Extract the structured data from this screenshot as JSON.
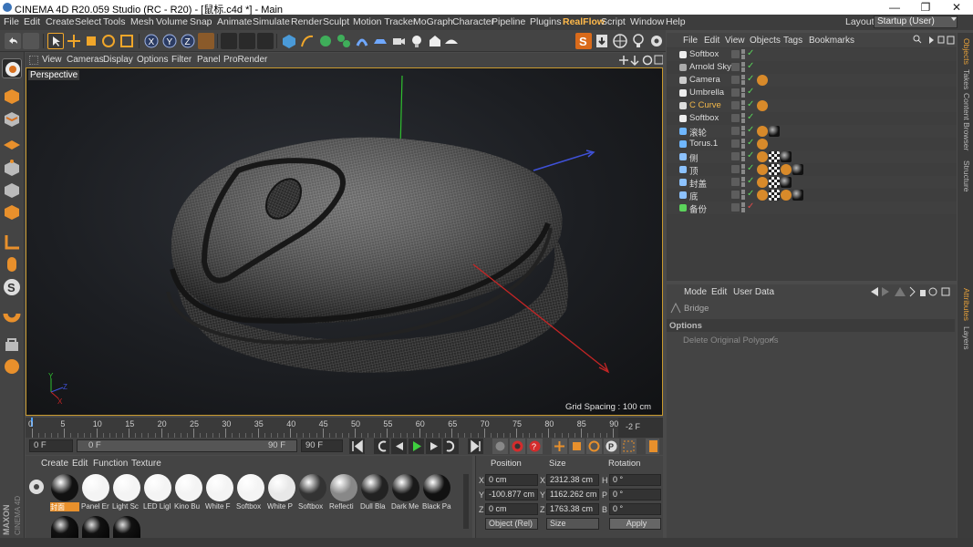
{
  "window": {
    "title": "CINEMA 4D R20.059 Studio (RC - R20) - [鼠标.c4d *] - Main",
    "minimize": "—",
    "maximize": "❐",
    "close": "✕"
  },
  "menubar": {
    "items": [
      "File",
      "Edit",
      "Create",
      "Select",
      "Tools",
      "Mesh",
      "Volume",
      "Snap",
      "Animate",
      "Simulate",
      "Render",
      "Sculpt",
      "Motion Tracker",
      "MoGraph",
      "Character",
      "Pipeline",
      "Plugins",
      "RealFlow",
      "Script",
      "Window",
      "Help"
    ],
    "layout_label": "Layout:",
    "layout_value": "Startup (User)"
  },
  "viewport": {
    "menu": [
      "View",
      "Cameras",
      "Display",
      "Options",
      "Filter",
      "Panel",
      "ProRender"
    ],
    "label": "Perspective",
    "grid_spacing": "Grid Spacing : 100 cm",
    "axis_labels": {
      "y": "Y",
      "z": "Z",
      "x": "X"
    }
  },
  "timeline": {
    "ticks": [
      "0",
      "5",
      "10",
      "15",
      "20",
      "25",
      "30",
      "35",
      "40",
      "45",
      "50",
      "55",
      "60",
      "65",
      "70",
      "75",
      "80",
      "85",
      "90"
    ],
    "frame_end_label": "-2 F",
    "start_field": "0 F",
    "slider_start": "0 F",
    "slider_end": "90 F",
    "end_field": "90 F"
  },
  "materials": {
    "menu": [
      "Create",
      "Edit",
      "Function",
      "Texture"
    ],
    "row1": [
      {
        "label": "封面",
        "color": "#111"
      },
      {
        "label": "Panel Er",
        "color": "#f4f4f4"
      },
      {
        "label": "Light Sc",
        "color": "#f4f4f4"
      },
      {
        "label": "LED Ligl",
        "color": "#f4f4f4"
      },
      {
        "label": "Kino Bu",
        "color": "#f4f4f4"
      },
      {
        "label": "White F",
        "color": "#f4f4f4"
      },
      {
        "label": "Softbox",
        "color": "#f4f4f4"
      },
      {
        "label": "White P",
        "color": "#e8e8e8"
      },
      {
        "label": "Softbox",
        "color": "#333"
      },
      {
        "label": "Reflecti",
        "color": "#888"
      },
      {
        "label": "Dull Bla",
        "color": "#222"
      },
      {
        "label": "Dark Me",
        "color": "#1a1a1a"
      },
      {
        "label": "Black Pa",
        "color": "#111"
      }
    ],
    "row2_count": 3
  },
  "coords": {
    "headers": [
      "Position",
      "Size",
      "Rotation"
    ],
    "rows": [
      {
        "axis": "X",
        "pos": "0 cm",
        "size_axis": "X",
        "size": "2312.38 cm",
        "rot_axis": "H",
        "rot": "0 °"
      },
      {
        "axis": "Y",
        "pos": "-100.877 cm",
        "size_axis": "Y",
        "size": "1162.262 cm",
        "rot_axis": "P",
        "rot": "0 °"
      },
      {
        "axis": "Z",
        "pos": "0 cm",
        "size_axis": "Z",
        "size": "1763.38 cm",
        "rot_axis": "B",
        "rot": "0 °"
      }
    ],
    "mode_select": "Object (Rel)",
    "size_select": "Size",
    "apply": "Apply"
  },
  "objects": {
    "menu": [
      "File",
      "Edit",
      "View",
      "Objects",
      "Tags",
      "Bookmarks"
    ],
    "rows": [
      {
        "name": "Softbox",
        "color": "#ddd",
        "icon": "#eee",
        "tags": []
      },
      {
        "name": "Arnold Sky",
        "color": "#ddd",
        "icon": "#aaa",
        "tags": []
      },
      {
        "name": "Camera",
        "color": "#ddd",
        "icon": "#ccc",
        "tags": [
          "#d88a2a"
        ]
      },
      {
        "name": "Umbrella",
        "color": "#ddd",
        "icon": "#eee",
        "tags": []
      },
      {
        "name": "C Curve",
        "color": "#f2b84a",
        "icon": "#ddd",
        "tags": [
          "#d88a2a"
        ]
      },
      {
        "name": "Softbox",
        "color": "#ddd",
        "icon": "#eee",
        "tags": []
      },
      {
        "name": "滚轮",
        "color": "#ddd",
        "icon": "#6fb7ff",
        "tags": [
          "#d88a2a",
          "#111"
        ]
      },
      {
        "name": "Torus.1",
        "color": "#ddd",
        "icon": "#6fb7ff",
        "tags": [
          "#d88a2a"
        ]
      },
      {
        "name": "侧",
        "color": "#ddd",
        "icon": "#8cc2ff",
        "tags": [
          "#d88a2a",
          "#888",
          "#222"
        ]
      },
      {
        "name": "顶",
        "color": "#ddd",
        "icon": "#8cc2ff",
        "tags": [
          "#d88a2a",
          "#888",
          "#d88a2a",
          "#111"
        ]
      },
      {
        "name": "封盖",
        "color": "#ddd",
        "icon": "#8cc2ff",
        "tags": [
          "#d88a2a",
          "#888",
          "#222"
        ]
      },
      {
        "name": "底",
        "color": "#ddd",
        "icon": "#8cc2ff",
        "tags": [
          "#d88a2a",
          "#888",
          "#d88a2a",
          "#111"
        ]
      },
      {
        "name": "备份",
        "color": "#ddd",
        "icon": "#5bd35b",
        "tags": []
      }
    ]
  },
  "attributes": {
    "menu": [
      "Mode",
      "Edit",
      "User Data"
    ],
    "object": "Bridge",
    "section": "Options",
    "option_label": "Delete Original Polygons",
    "option_check": "✓"
  },
  "right_tabs": [
    "Objects",
    "Takes",
    "Content Browser",
    "Structure",
    "Attributes",
    "Layers"
  ],
  "brand": {
    "maxon": "MAXON",
    "cinema": "CINEMA 4D"
  }
}
